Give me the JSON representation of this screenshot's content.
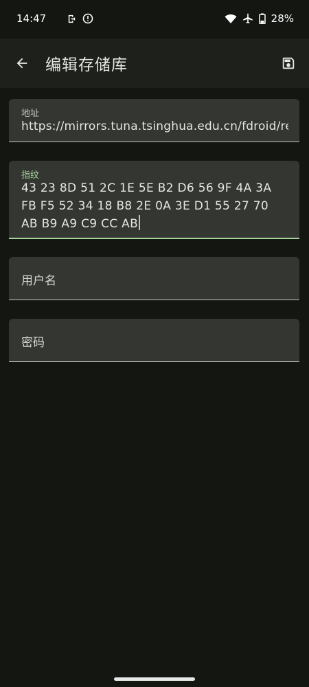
{
  "status_bar": {
    "time": "14:47",
    "battery": "28%"
  },
  "app_bar": {
    "title": "编辑存储库"
  },
  "fields": {
    "address": {
      "label": "地址",
      "value": "https://mirrors.tuna.tsinghua.edu.cn/fdroid/rep"
    },
    "fingerprint": {
      "label": "指纹",
      "value": "43 23 8D 51 2C 1E 5E B2 D6 56 9F 4A 3A FB F5 52 34 18 B8 2E 0A 3E D1 55 27 70 AB B9 A9 C9 CC AB"
    },
    "username": {
      "placeholder": "用户名"
    },
    "password": {
      "placeholder": "密码"
    }
  },
  "colors": {
    "background": "#141612",
    "app_bar": "#1d201b",
    "field": "#343632",
    "accent": "#a4d49a"
  }
}
